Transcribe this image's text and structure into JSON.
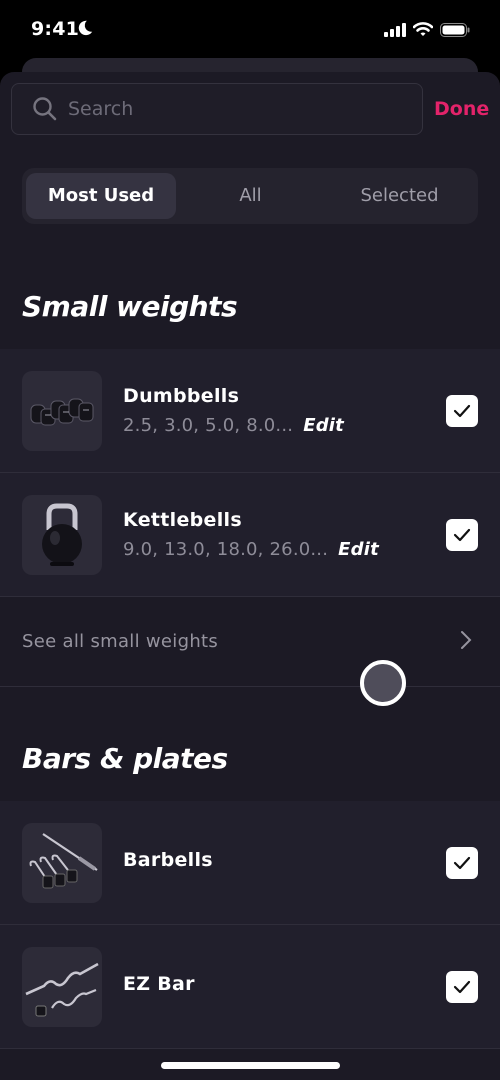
{
  "status_bar": {
    "time": "9:41",
    "icons": [
      "moon-icon",
      "signal-icon",
      "wifi-icon",
      "battery-icon"
    ]
  },
  "search": {
    "placeholder": "Search",
    "value": "",
    "icon": "search-icon"
  },
  "header": {
    "done_label": "Done",
    "accent_color": "#e3236a"
  },
  "tabs": [
    {
      "label": "Most Used",
      "active": true
    },
    {
      "label": "All",
      "active": false
    },
    {
      "label": "Selected",
      "active": false
    }
  ],
  "sections": [
    {
      "title": "Small weights",
      "items": [
        {
          "name": "Dumbbells",
          "weights": "2.5, 3.0, 5.0, 8.0...",
          "edit_label": "Edit",
          "checked": true,
          "image": "dumbbells-image"
        },
        {
          "name": "Kettlebells",
          "weights": "9.0, 13.0, 18.0, 26.0...",
          "edit_label": "Edit",
          "checked": true,
          "image": "kettlebell-image"
        }
      ],
      "see_all_label": "See all small weights"
    },
    {
      "title": "Bars & plates",
      "items": [
        {
          "name": "Barbells",
          "checked": true,
          "image": "barbells-image"
        },
        {
          "name": "EZ Bar",
          "checked": true,
          "image": "ez-bar-image"
        }
      ]
    }
  ]
}
